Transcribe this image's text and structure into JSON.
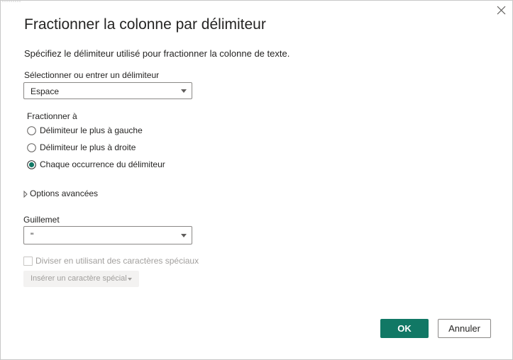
{
  "dialog": {
    "title": "Fractionner la colonne par délimiteur",
    "description": "Spécifiez le délimiteur utilisé pour fractionner la colonne de texte.",
    "close_icon": "close-icon"
  },
  "delimiter": {
    "label": "Sélectionner ou entrer un délimiteur",
    "value": "Espace"
  },
  "split_at": {
    "label": "Fractionner à",
    "options": [
      {
        "label": "Délimiteur le plus à gauche",
        "selected": false
      },
      {
        "label": "Délimiteur le plus à droite",
        "selected": false
      },
      {
        "label": "Chaque occurrence du délimiteur",
        "selected": true
      }
    ]
  },
  "advanced": {
    "label": "Options avancées",
    "expanded": false
  },
  "quote": {
    "label": "Guillemet",
    "value": "\""
  },
  "special_chars": {
    "checkbox_label": "Diviser en utilisant des caractères spéciaux",
    "checked": false,
    "disabled": true,
    "insert_button_label": "Insérer un caractère spécial"
  },
  "buttons": {
    "ok": "OK",
    "cancel": "Annuler"
  },
  "colors": {
    "accent": "#117865",
    "text": "#252423",
    "disabled_text": "#a19f9d",
    "border": "#8a8886"
  }
}
